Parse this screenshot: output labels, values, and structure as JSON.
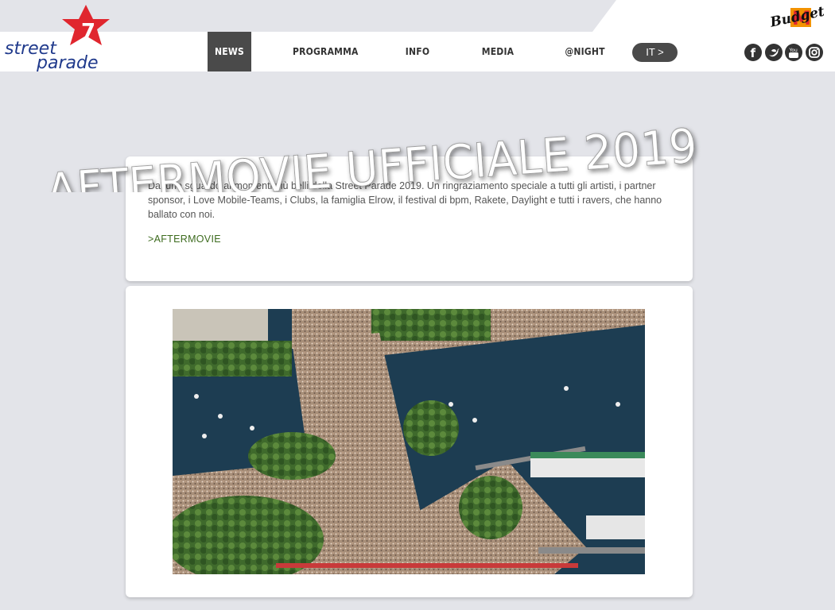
{
  "sponsor": {
    "name": "Budget",
    "mark": "M"
  },
  "brand": {
    "line1": "street",
    "line2": "parade",
    "badge_number": "7"
  },
  "nav": {
    "items": [
      {
        "label": "NEWS",
        "active": true
      },
      {
        "label": "PROGRAMMA",
        "active": false
      },
      {
        "label": "INFO",
        "active": false
      },
      {
        "label": "MEDIA",
        "active": false
      },
      {
        "label": "@NIGHT",
        "active": false
      }
    ],
    "language": "IT  >"
  },
  "social": [
    "facebook-icon",
    "twitter-icon",
    "youtube-icon",
    "instagram-icon"
  ],
  "headline": "AFTERMOVIE UFFICIALE 2019",
  "article": {
    "intro": "Dai uno sguardo ai momenti più belli della Street Parade 2019. Un ringraziamento speciale a tutti gli artisti, i partner sponsor, i Love Mobile-Teams, i Clubs, la famiglia Elrow, il festival di bpm, Rakete, Daylight e tutti i ravers, che hanno ballato con noi.",
    "link": ">AFTERMOVIE"
  },
  "colors": {
    "accent_red": "#e0262e",
    "nav_dark": "#4a4a4a",
    "link_green": "#3d6b1e",
    "page_bg": "#e3e4e9"
  }
}
